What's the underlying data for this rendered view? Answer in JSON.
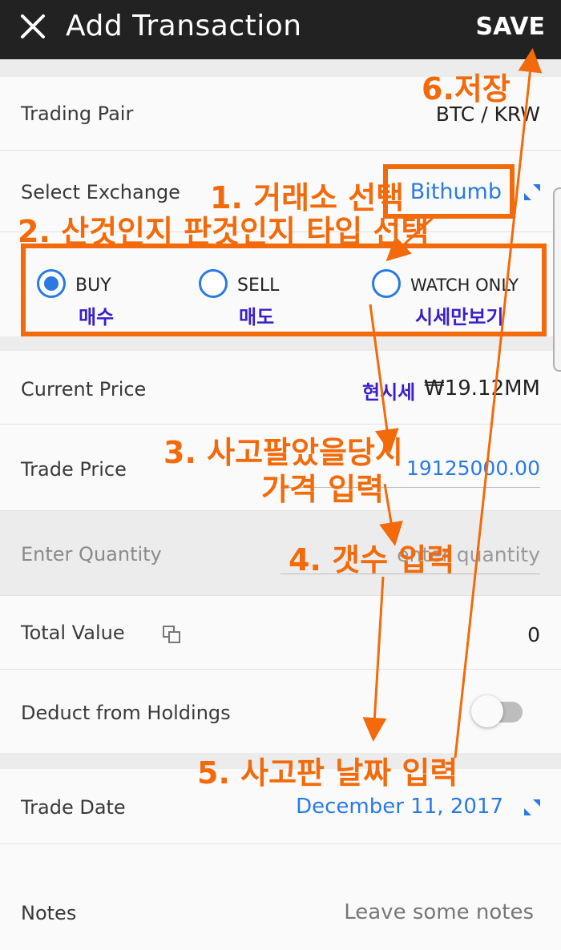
{
  "header": {
    "title": "Add Transaction",
    "save_label": "SAVE"
  },
  "trading_pair": {
    "label": "Trading Pair",
    "value": "BTC / KRW"
  },
  "exchange": {
    "label": "Select Exchange",
    "value": "Bithumb"
  },
  "type_options": [
    {
      "label": "BUY",
      "korean": "매수",
      "selected": true
    },
    {
      "label": "SELL",
      "korean": "매도",
      "selected": false
    },
    {
      "label": "WATCH ONLY",
      "korean": "시세만보기",
      "selected": false
    }
  ],
  "current_price": {
    "label": "Current Price",
    "korean": "현시세",
    "value": "₩19.12MM"
  },
  "trade_price": {
    "label": "Trade Price",
    "value": "19125000.00"
  },
  "quantity": {
    "label": "Enter Quantity",
    "placeholder": "enter quantity"
  },
  "total_value": {
    "label": "Total Value",
    "value": "0"
  },
  "deduct": {
    "label": "Deduct from  Holdings",
    "enabled": false
  },
  "trade_date": {
    "label": "Trade Date",
    "value": "December 11, 2017"
  },
  "notes": {
    "label": "Notes",
    "placeholder": "Leave some notes"
  },
  "annotations": {
    "step1": "1. 거래소 선택",
    "step2": "2. 산것인지 판것인지 타입 선택",
    "step3_line1": "3. 사고팔았을당시",
    "step3_line2": "가격 입력",
    "step4": "4. 갯수 입력",
    "step5": "5. 사고판 날짜 입력",
    "step6": "6.저장"
  },
  "colors": {
    "accent": "#2a7ae2",
    "annotation": "#f26a0a",
    "korean_label": "#3a1fc8",
    "appbar": "#222222"
  }
}
